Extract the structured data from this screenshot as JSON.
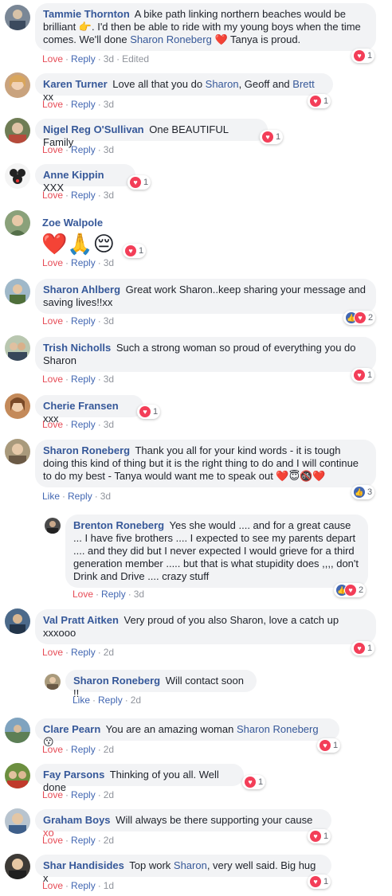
{
  "comments": [
    {
      "name": "Tammie Thornton",
      "parts": [
        "A bike path linking northern beaches would be brilliant ",
        "👉",
        ". I'd then be able to ride with my young boys when the time comes. We'll done ",
        "Sharon Roneberg",
        " ❤️ Tanya is proud."
      ],
      "actions": {
        "love": "Love",
        "reply": "Reply",
        "time": "3d",
        "edited": "Edited"
      },
      "reaction_count": "1"
    },
    {
      "name": "Karen Turner",
      "parts": [
        "Love all that you do ",
        "Sharon",
        ", Geoff and ",
        "Brett",
        " xx"
      ],
      "actions": {
        "love": "Love",
        "reply": "Reply",
        "time": "3d"
      },
      "reaction_count": "1"
    },
    {
      "name": "Nigel Reg O'Sullivan",
      "text": "One BEAUTIFUL Family",
      "actions": {
        "love": "Love",
        "reply": "Reply",
        "time": "3d"
      },
      "reaction_count": "1"
    },
    {
      "name": "Anne Kippin",
      "text": "XXX",
      "actions": {
        "love": "Love",
        "reply": "Reply",
        "time": "3d"
      },
      "reaction_count": "1"
    },
    {
      "name": "Zoe Walpole",
      "emojis": [
        "❤️",
        "🙏",
        "😔"
      ],
      "actions": {
        "love": "Love",
        "reply": "Reply",
        "time": "3d"
      },
      "reaction_count": "1"
    },
    {
      "name": "Sharon Ahlberg",
      "text": "Great work Sharon..keep sharing your message and saving lives!!xx",
      "actions": {
        "love": "Love",
        "reply": "Reply",
        "time": "3d"
      },
      "reaction_count": "2"
    },
    {
      "name": "Trish Nicholls",
      "text": "Such a strong woman so proud of everything you do Sharon",
      "actions": {
        "love": "Love",
        "reply": "Reply",
        "time": "3d"
      },
      "reaction_count": "1"
    },
    {
      "name": "Cherie Fransen",
      "text": "xxx",
      "actions": {
        "love": "Love",
        "reply": "Reply",
        "time": "3d"
      },
      "reaction_count": "1"
    },
    {
      "name": "Sharon Roneberg",
      "text": "Thank you all for your kind words - it is tough doing this kind of thing but it is the right thing to do and I will continue to do my best - Tanya would want me to speak out ❤️😇🚳❤️",
      "actions": {
        "like": "Like",
        "reply": "Reply",
        "time": "3d"
      },
      "reaction_count": "3"
    },
    {
      "name": "Brenton Roneberg",
      "text": "Yes she would .... and for a great cause ... I have five brothers .... I expected to see my parents depart .... and they did but I never expected I would grieve for a third generation member ..... but that is what stupidity does ,,,, don't Drink and Drive .... crazy stuff",
      "actions": {
        "love": "Love",
        "reply": "Reply",
        "time": "3d"
      },
      "reaction_count": "2"
    },
    {
      "name": "Val Pratt Aitken",
      "text": "Very proud of you also Sharon, love a catch up xxxooo",
      "actions": {
        "love": "Love",
        "reply": "Reply",
        "time": "2d"
      },
      "reaction_count": "1"
    },
    {
      "name": "Sharon Roneberg",
      "text": "Will contact soon !!",
      "actions": {
        "like": "Like",
        "reply": "Reply",
        "time": "2d"
      }
    },
    {
      "name": "Clare Pearn",
      "parts": [
        "You are an amazing woman ",
        "Sharon Roneberg",
        " 😗"
      ],
      "actions": {
        "love": "Love",
        "reply": "Reply",
        "time": "2d"
      },
      "reaction_count": "1"
    },
    {
      "name": "Fay Parsons",
      "text": "Thinking of you all. Well done",
      "actions": {
        "love": "Love",
        "reply": "Reply",
        "time": "2d"
      },
      "reaction_count": "1"
    },
    {
      "name": "Graham Boys",
      "parts": [
        "Will always be there supporting your cause ",
        "xo"
      ],
      "actions": {
        "love": "Love",
        "reply": "Reply",
        "time": "2d"
      },
      "reaction_count": "1"
    },
    {
      "name": "Shar Handisides",
      "parts": [
        "Top work ",
        "Sharon",
        ", very well said. Big hug x"
      ],
      "actions": {
        "love": "Love",
        "reply": "Reply",
        "time": "1d"
      },
      "reaction_count": "1"
    }
  ],
  "colors": {
    "name": "#365899",
    "love": "#e64b56",
    "like": "#4267b2",
    "bubble": "#f2f3f5",
    "meta": "#90949c",
    "heart_badge": "#f33e58"
  },
  "icons": {
    "heart": "heart-icon",
    "like": "thumbs-up-icon"
  }
}
